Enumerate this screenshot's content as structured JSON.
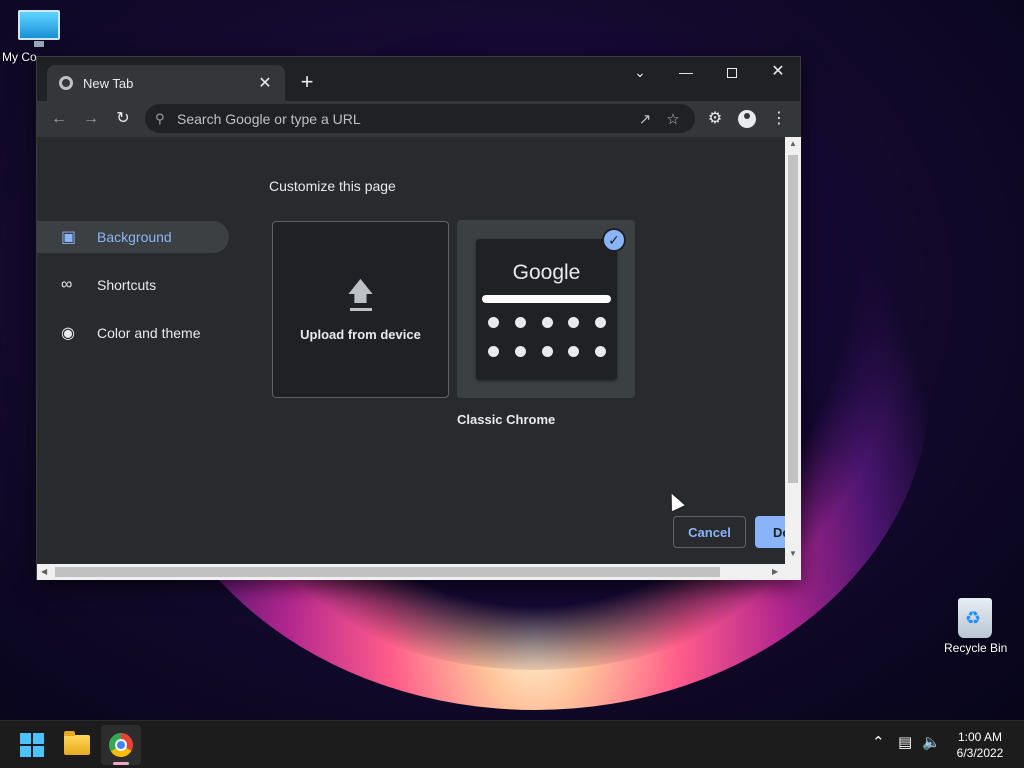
{
  "desktop": {
    "icons": [
      {
        "label": "My Co",
        "icon": "monitor-icon"
      },
      {
        "label": "Recycle Bin",
        "icon": "recycle-bin-icon"
      }
    ]
  },
  "browser": {
    "tab": {
      "title": "New Tab",
      "icon": "chrome-icon",
      "close": "✕"
    },
    "new_tab": "+",
    "window_controls": {
      "tab_search": "⌄",
      "minimize": "—",
      "close": "✕"
    },
    "toolbar": {
      "back": "←",
      "forward": "→",
      "reload": "↻",
      "omnibox_placeholder": "Search Google or type a URL",
      "icons": [
        "search-icon",
        "share-icon",
        "star-icon",
        "extensions-icon",
        "profile-icon",
        "menu-icon"
      ]
    }
  },
  "customize": {
    "title": "Customize this page",
    "nav": [
      {
        "label": "Background",
        "icon": "image-icon",
        "active": true
      },
      {
        "label": "Shortcuts",
        "icon": "link-icon",
        "active": false
      },
      {
        "label": "Color and theme",
        "icon": "palette-icon",
        "active": false
      }
    ],
    "tiles": {
      "upload_label": "Upload from device",
      "classic_label": "Classic Chrome",
      "preview_logo": "Google",
      "selected": "Classic Chrome"
    },
    "buttons": {
      "cancel": "Cancel",
      "done": "Do"
    }
  },
  "taskbar": {
    "apps": [
      "start-icon",
      "file-explorer-icon",
      "chrome-icon"
    ],
    "tray_icons": [
      "chevron-up-icon",
      "network-icon",
      "volume-icon"
    ],
    "time": "1:00 AM",
    "date": "6/3/2022"
  },
  "colors": {
    "accent": "#8ab4f8",
    "surface": "#292a2d",
    "toolbar": "#35363a"
  }
}
